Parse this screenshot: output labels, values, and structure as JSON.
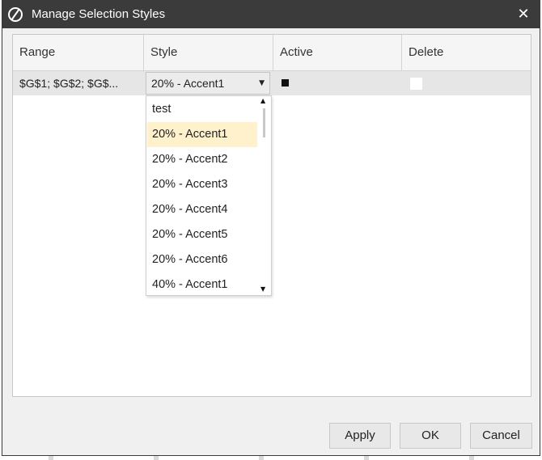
{
  "dialog": {
    "title": "Manage Selection Styles",
    "close_glyph": "✕",
    "logo_icon": "app-logo-icon"
  },
  "grid": {
    "columns": [
      "Range",
      "Style",
      "Active",
      "Delete"
    ],
    "rows": [
      {
        "range": "$G$1; $G$2; $G$...",
        "style": "20% - Accent1",
        "active": true,
        "delete": false
      }
    ]
  },
  "dropdown": {
    "options": [
      "test",
      "20% - Accent1",
      "20% - Accent2",
      "20% - Accent3",
      "20% - Accent4",
      "20% - Accent5",
      "20% - Accent6",
      "40% - Accent1"
    ],
    "selected": "20% - Accent1"
  },
  "buttons": {
    "apply": "Apply",
    "ok": "OK",
    "cancel": "Cancel"
  },
  "colors": {
    "titlebar": "#3b3b3b",
    "selected_option": "#fff1cc"
  }
}
